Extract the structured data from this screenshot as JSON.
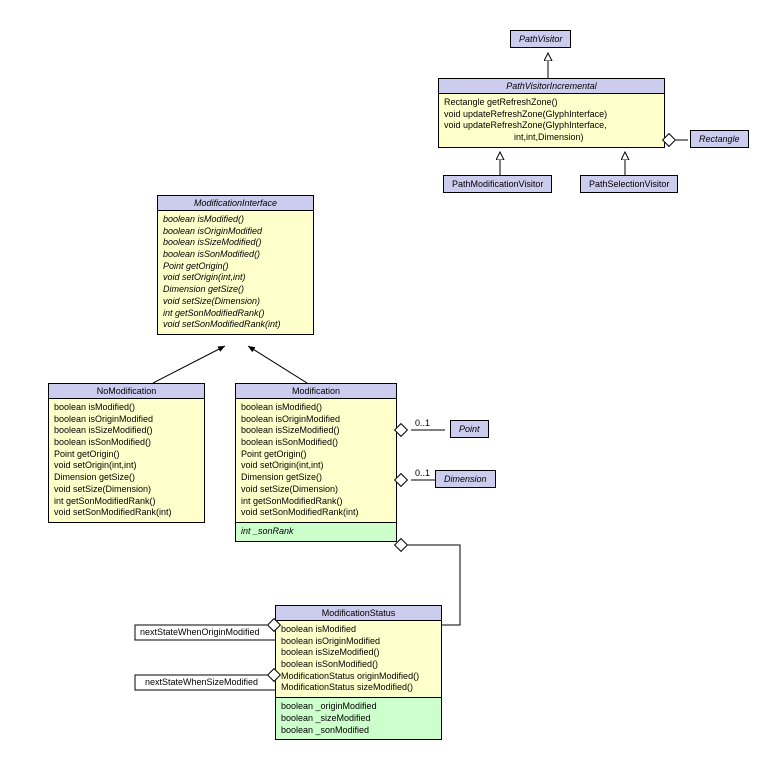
{
  "pathVisitor": {
    "title": "PathVisitor"
  },
  "pathVisitorIncremental": {
    "title": "PathVisitorIncremental",
    "m1": "Rectangle getRefreshZone()",
    "m2": "void updateRefreshZone(GlyphInterface)",
    "m3": "void updateRefreshZone(GlyphInterface,",
    "m4": "int,int,Dimension)"
  },
  "pathModificationVisitor": {
    "title": "PathModificationVisitor"
  },
  "pathSelectionVisitor": {
    "title": "PathSelectionVisitor"
  },
  "rectangle": {
    "title": "Rectangle"
  },
  "modInterface": {
    "title": "ModificationInterface",
    "m1": "boolean isModified()",
    "m2": "boolean isOriginModified",
    "m3": "boolean isSizeModified()",
    "m4": "boolean isSonModified()",
    "m5": "Point getOrigin()",
    "m6": "void setOrigin(int,int)",
    "m7": "Dimension getSize()",
    "m8": "void setSize(Dimension)",
    "m9": "int getSonModifiedRank()",
    "m10": "void setSonModifiedRank(int)"
  },
  "noMod": {
    "title": "NoModification",
    "m1": "boolean isModified()",
    "m2": "boolean isOriginModified",
    "m3": "boolean isSizeModified()",
    "m4": "boolean isSonModified()",
    "m5": "Point getOrigin()",
    "m6": "void setOrigin(int,int)",
    "m7": "Dimension getSize()",
    "m8": "void setSize(Dimension)",
    "m9": "int getSonModifiedRank()",
    "m10": "void setSonModifiedRank(int)"
  },
  "mod": {
    "title": "Modification",
    "m1": "boolean isModified()",
    "m2": "boolean isOriginModified",
    "m3": "boolean isSizeModified()",
    "m4": "boolean isSonModified()",
    "m5": "Point getOrigin()",
    "m6": "void setOrigin(int,int)",
    "m7": "Dimension getSize()",
    "m8": "void setSize(Dimension)",
    "m9": "int getSonModifiedRank()",
    "m10": "void setSonModifiedRank(int)",
    "attr": "int _sonRank"
  },
  "point": {
    "title": "Point"
  },
  "dimension": {
    "title": "Dimension"
  },
  "modStatus": {
    "title": "ModificationStatus",
    "m1": "boolean isModified",
    "m2": "boolean isOriginModified",
    "m3": "boolean isSizeModified()",
    "m4": "boolean isSonModified()",
    "m5": "ModificationStatus originModified()",
    "m6": "ModificationStatus sizeModified()",
    "a1": "boolean _originModified",
    "a2": "boolean _sizeModified",
    "a3": "boolean _sonModified"
  },
  "labels": {
    "lbl01a": "0..1",
    "lbl01b": "0..1",
    "nextOrigin": "nextStateWhenOriginModified",
    "nextSize": "nextStateWhenSizeModified"
  }
}
